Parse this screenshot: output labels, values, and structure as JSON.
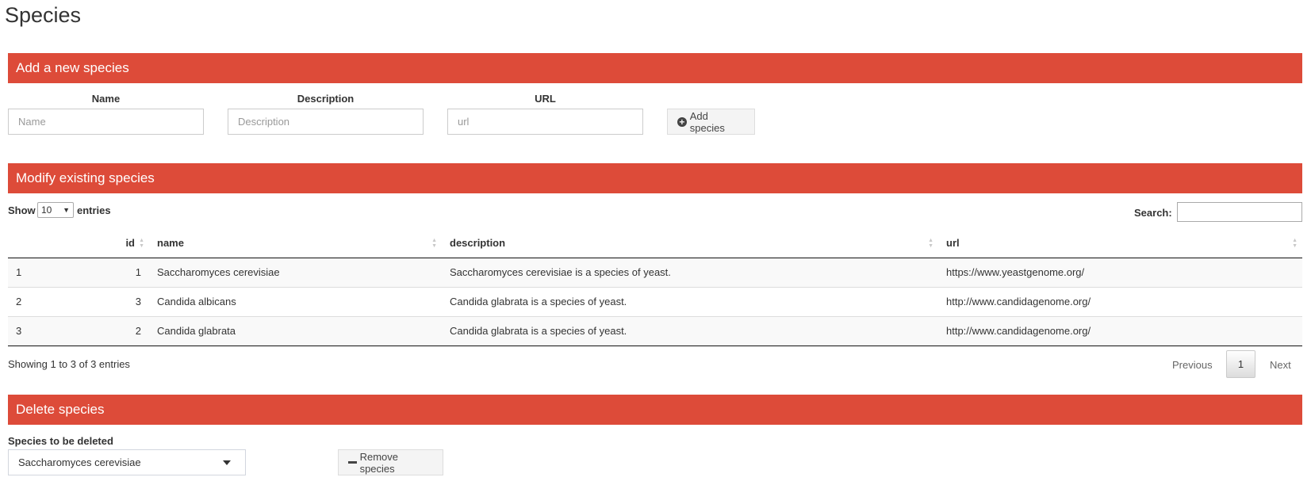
{
  "page": {
    "title": "Species"
  },
  "add_section": {
    "header": "Add a new species",
    "name_label": "Name",
    "name_placeholder": "Name",
    "description_label": "Description",
    "description_placeholder": "Description",
    "url_label": "URL",
    "url_placeholder": "url",
    "add_button_label": "Add species"
  },
  "modify_section": {
    "header": "Modify existing species",
    "show_label": "Show",
    "entries_label": "entries",
    "page_length": "10",
    "search_label": "Search:",
    "columns": [
      "",
      "id",
      "name",
      "description",
      "url"
    ],
    "rows": [
      {
        "index": "1",
        "id": "1",
        "name": "Saccharomyces cerevisiae",
        "description": "Saccharomyces cerevisiae is a species of yeast.",
        "url": "https://www.yeastgenome.org/"
      },
      {
        "index": "2",
        "id": "3",
        "name": "Candida albicans",
        "description": "Candida glabrata is a species of yeast.",
        "url": "http://www.candidagenome.org/"
      },
      {
        "index": "3",
        "id": "2",
        "name": "Candida glabrata",
        "description": "Candida glabrata is a species of yeast.",
        "url": "http://www.candidagenome.org/"
      }
    ],
    "info": "Showing 1 to 3 of 3 entries",
    "pagination": {
      "previous": "Previous",
      "current": "1",
      "next": "Next"
    }
  },
  "delete_section": {
    "header": "Delete species",
    "select_label": "Species to be deleted",
    "selected_value": "Saccharomyces cerevisiae",
    "remove_button_label": "Remove species"
  },
  "colors": {
    "header_bg": "#dd4b39",
    "button_bg": "#f4f4f4"
  },
  "icons": {
    "add": "plus-circle-icon",
    "remove": "minus-icon",
    "dropdown": "caret-down-icon",
    "sort": "sort-icon"
  }
}
